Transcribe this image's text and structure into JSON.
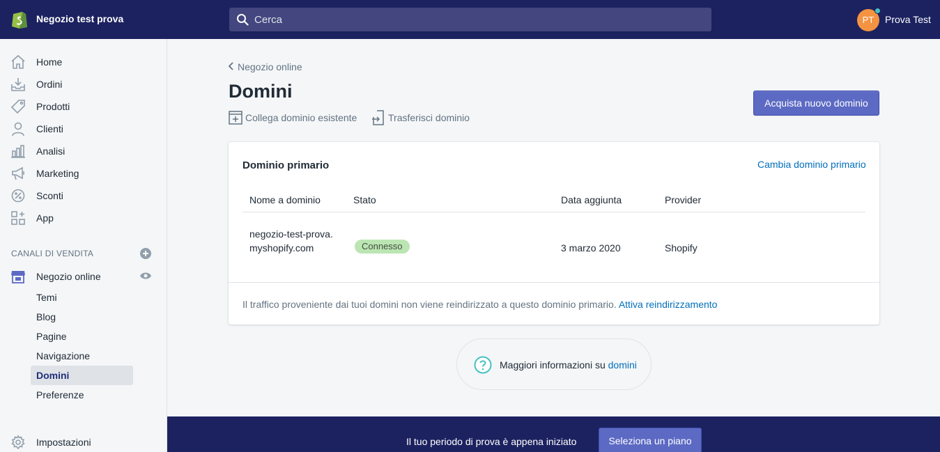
{
  "topbar": {
    "store_name": "Negozio test prova",
    "search_placeholder": "Cerca",
    "avatar_initials": "PT",
    "user_name": "Prova Test",
    "colors": {
      "background": "#1c2260",
      "avatar": "#f49342",
      "status_dot": "#47c1bf"
    }
  },
  "sidebar": {
    "items": [
      {
        "label": "Home",
        "icon": "home-icon"
      },
      {
        "label": "Ordini",
        "icon": "orders-icon"
      },
      {
        "label": "Prodotti",
        "icon": "tag-icon"
      },
      {
        "label": "Clienti",
        "icon": "person-icon"
      },
      {
        "label": "Analisi",
        "icon": "bar-chart-icon"
      },
      {
        "label": "Marketing",
        "icon": "megaphone-icon"
      },
      {
        "label": "Sconti",
        "icon": "discount-icon"
      },
      {
        "label": "App",
        "icon": "apps-icon"
      }
    ],
    "sales_channels_title": "CANALI DI VENDITA",
    "online_store": {
      "label": "Negozio online",
      "sub_items": [
        "Temi",
        "Blog",
        "Pagine",
        "Navigazione",
        "Domini",
        "Preferenze"
      ],
      "active": "Domini"
    },
    "settings_label": "Impostazioni"
  },
  "main": {
    "breadcrumb": "Negozio online",
    "title": "Domini",
    "actions": {
      "connect_existing": "Collega dominio esistente",
      "transfer": "Trasferisci dominio"
    },
    "buy_button": "Acquista nuovo dominio",
    "primary_card": {
      "title": "Dominio primario",
      "change_link": "Cambia dominio primario",
      "columns": [
        "Nome a dominio",
        "Stato",
        "Data aggiunta",
        "Provider"
      ],
      "row": {
        "domain": "negozio-test-prova.myshopify.com",
        "status": "Connesso",
        "date_added": "3 marzo 2020",
        "provider": "Shopify"
      },
      "footer_text": "Il traffico proveniente dai tuoi domini non viene reindirizzato a questo dominio primario.",
      "footer_link": "Attiva reindirizzamento"
    },
    "help": {
      "text": "Maggiori informazioni su",
      "link": "domini"
    }
  },
  "trial_bar": {
    "text": "Il tuo periodo di prova è appena iniziato",
    "button": "Seleziona un piano"
  },
  "colors": {
    "accent": "#5c6ac4",
    "link": "#006fbb",
    "badge_success": "#bbe5b3"
  }
}
